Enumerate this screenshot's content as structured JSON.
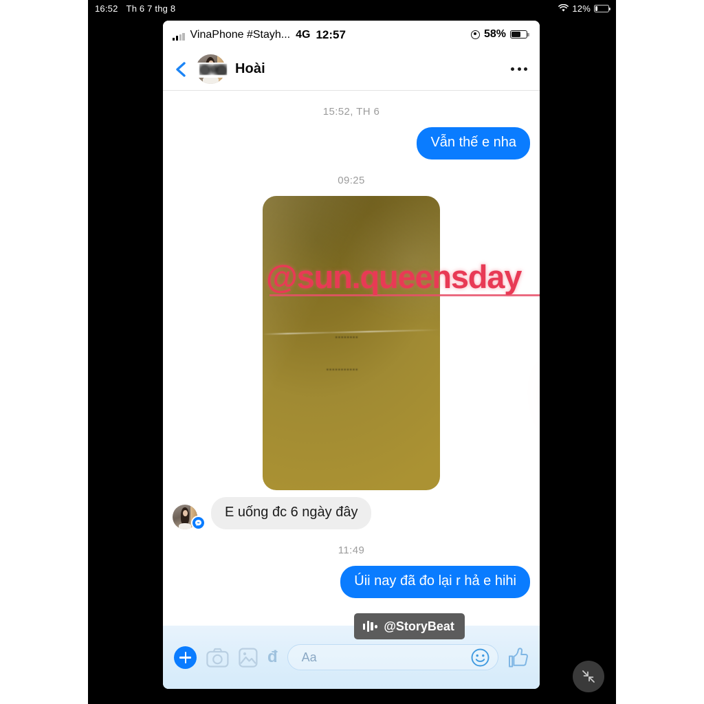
{
  "os_status_bar": {
    "time": "16:52",
    "date": "Th 6 7 thg 8",
    "wifi_icon": "wifi-icon",
    "battery_percent": "12%",
    "battery_level": 12
  },
  "phone_status_bar": {
    "signal_icon": "signal-bars-icon",
    "carrier": "VinaPhone #Stayh...",
    "network": "4G",
    "time": "12:57",
    "location_icon": "location-services-icon",
    "battery_percent": "58%",
    "battery_level": 58
  },
  "chat_header": {
    "back_icon": "back-chevron-icon",
    "avatar": "contact-avatar",
    "contact_name": "Hoài",
    "more_icon": "more-options-icon"
  },
  "conversation": {
    "messages": [
      {
        "type": "timestamp",
        "text": "15:52, TH 6"
      },
      {
        "type": "outgoing",
        "text": "Vẫn thế e nha"
      },
      {
        "type": "timestamp",
        "text": "09:25"
      },
      {
        "type": "photo",
        "alt": "photo-attachment"
      },
      {
        "type": "incoming",
        "text": "E uống đc 6 ngày đây"
      },
      {
        "type": "timestamp",
        "text": "11:49"
      },
      {
        "type": "outgoing",
        "text": "Úii nay đã đo lại r hả e hihi"
      }
    ]
  },
  "watermarks": {
    "handle": "@sun.queensday",
    "handle_color": "#e83a55",
    "check_icon": "checkmark-icon",
    "storybeat_label": "@StoryBeat",
    "storybeat_icon": "waveform-icon"
  },
  "composer": {
    "plus_icon": "add-plus-icon",
    "camera_icon": "camera-icon",
    "gallery_icon": "gallery-image-icon",
    "money_icon": "dong-currency-icon",
    "input_placeholder": "Aa",
    "emoji_icon": "emoji-smiley-icon",
    "like_icon": "thumbs-up-icon"
  },
  "floating_controls": {
    "shrink_icon": "shrink-collapse-icon"
  },
  "colors": {
    "accent_blue": "#0a7cff",
    "incoming_gray": "#eeeeee",
    "watermark_red": "#e83a55",
    "composer_blue": "#dceefb"
  }
}
